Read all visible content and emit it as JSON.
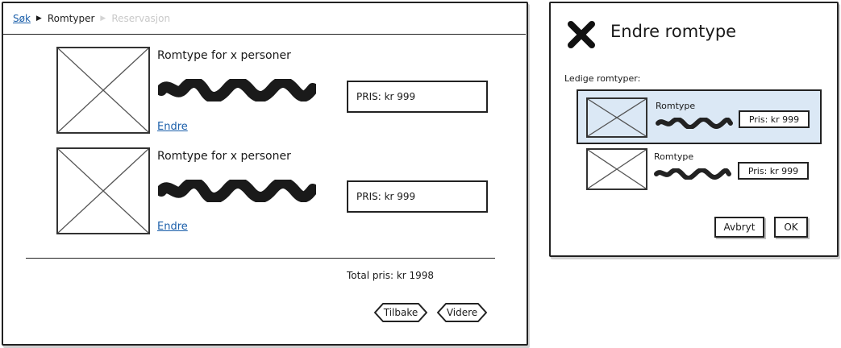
{
  "breadcrumb": {
    "item1": "Søk",
    "item2": "Romtyper",
    "item3": "Reservasjon"
  },
  "rooms": [
    {
      "title": "Romtype for x personer",
      "edit_link": "Endre",
      "price": "PRIS: kr 999"
    },
    {
      "title": "Romtype for x personer",
      "edit_link": "Endre",
      "price": "PRIS: kr 999"
    }
  ],
  "total": "Total pris: kr 1998",
  "buttons": {
    "back": "Tilbake",
    "next": "Videre"
  },
  "dialog": {
    "title": "Endre romtype",
    "label": "Ledige romtyper:",
    "options": [
      {
        "title": "Romtype",
        "price": "Pris: kr 999",
        "selected": true
      },
      {
        "title": "Romtype",
        "price": "Pris: kr 999",
        "selected": false
      }
    ],
    "cancel": "Avbryt",
    "ok": "OK"
  },
  "colors": {
    "link": "#1b5faa",
    "selected_bg": "#dbe8f5",
    "disabled": "#c9c9c9"
  }
}
